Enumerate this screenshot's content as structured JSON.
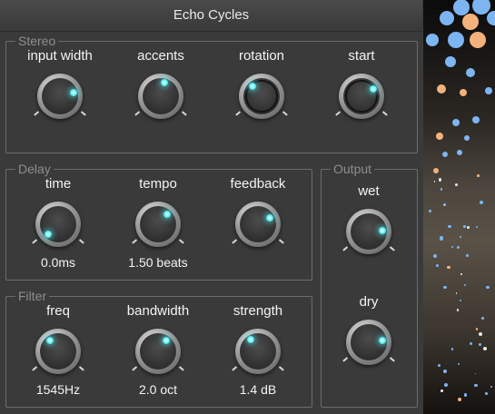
{
  "window": {
    "title": "Echo Cycles"
  },
  "colors": {
    "accent": "#5cf0f0",
    "bubble_blue": "#7db5f2",
    "bubble_orange": "#f3b27d"
  },
  "groups": {
    "stereo": {
      "title": "Stereo",
      "controls": [
        {
          "label": "input width",
          "value": "",
          "level": 0.78,
          "ringed": false
        },
        {
          "label": "accents",
          "value": "",
          "level": 0.55,
          "ringed": false
        },
        {
          "label": "rotation",
          "value": "",
          "level": 0.35,
          "ringed": true
        },
        {
          "label": "start",
          "value": "",
          "level": 0.72,
          "ringed": true
        }
      ]
    },
    "delay": {
      "title": "Delay",
      "controls": [
        {
          "label": "time",
          "value": "0.0ms",
          "level": 0.0,
          "ringed": false
        },
        {
          "label": "tempo",
          "value": "1.50 beats",
          "level": 0.66,
          "ringed": false
        },
        {
          "label": "feedback",
          "value": "",
          "level": 0.73,
          "ringed": false
        }
      ]
    },
    "filter": {
      "title": "Filter",
      "controls": [
        {
          "label": "freq",
          "value": "1545Hz",
          "level": 0.36,
          "ringed": false
        },
        {
          "label": "bandwidth",
          "value": "2.0 oct",
          "level": 0.63,
          "ringed": false
        },
        {
          "label": "strength",
          "value": "1.4 dB",
          "level": 0.38,
          "ringed": false
        }
      ]
    },
    "output": {
      "title": "Output",
      "controls": [
        {
          "label": "wet",
          "value": "",
          "level": 0.82,
          "ringed": false
        },
        {
          "label": "dry",
          "value": "",
          "level": 0.8,
          "ringed": false
        }
      ]
    }
  }
}
